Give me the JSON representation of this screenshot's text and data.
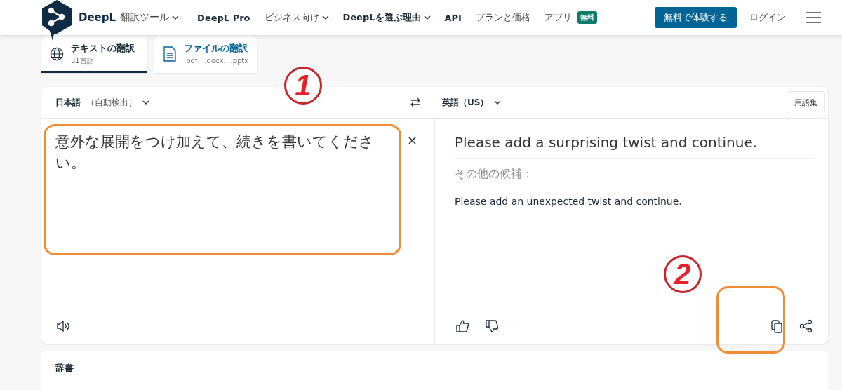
{
  "header": {
    "logo_text": "DeepL",
    "product": "翻訳ツール",
    "nav": [
      {
        "label": "DeepL Pro",
        "kind": "bold"
      },
      {
        "label": "ビジネス向け",
        "kind": "dropdown"
      },
      {
        "label": "DeepLを選ぶ理由",
        "kind": "bold-dropdown"
      },
      {
        "label": "API",
        "kind": "bold"
      },
      {
        "label": "プランと価格",
        "kind": "plain"
      },
      {
        "label": "アプリ",
        "kind": "badge",
        "badge": "無料"
      }
    ],
    "cta": "無料で体験する",
    "login": "ログイン"
  },
  "mode_tabs": [
    {
      "title": "テキストの翻訳",
      "subtitle": "31言語",
      "selected": true
    },
    {
      "title": "ファイルの翻訳",
      "subtitle": ".pdf、.docx、.pptx",
      "selected": false
    }
  ],
  "source": {
    "language": "日本語",
    "detected": "（自動検出）",
    "text": "意外な展開をつけ加えて、続きを書いてください。",
    "clear_button": "×"
  },
  "target": {
    "language": "英語（US）",
    "glossary": "用語集",
    "translation": "Please add a surprising twist and continue.",
    "alternatives_label": "その他の候補：",
    "alternatives": [
      "Please add an unexpected twist and continue."
    ]
  },
  "dictionary": {
    "title": "辞書"
  },
  "annotations": [
    {
      "label": "1"
    },
    {
      "label": "2"
    }
  ]
}
